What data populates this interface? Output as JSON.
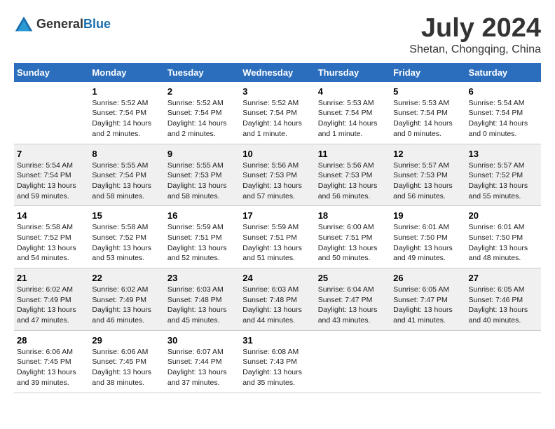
{
  "header": {
    "logo_general": "General",
    "logo_blue": "Blue",
    "title": "July 2024",
    "location": "Shetan, Chongqing, China"
  },
  "columns": [
    "Sunday",
    "Monday",
    "Tuesday",
    "Wednesday",
    "Thursday",
    "Friday",
    "Saturday"
  ],
  "weeks": [
    [
      {
        "day": "",
        "info": ""
      },
      {
        "day": "1",
        "info": "Sunrise: 5:52 AM\nSunset: 7:54 PM\nDaylight: 14 hours\nand 2 minutes."
      },
      {
        "day": "2",
        "info": "Sunrise: 5:52 AM\nSunset: 7:54 PM\nDaylight: 14 hours\nand 2 minutes."
      },
      {
        "day": "3",
        "info": "Sunrise: 5:52 AM\nSunset: 7:54 PM\nDaylight: 14 hours\nand 1 minute."
      },
      {
        "day": "4",
        "info": "Sunrise: 5:53 AM\nSunset: 7:54 PM\nDaylight: 14 hours\nand 1 minute."
      },
      {
        "day": "5",
        "info": "Sunrise: 5:53 AM\nSunset: 7:54 PM\nDaylight: 14 hours\nand 0 minutes."
      },
      {
        "day": "6",
        "info": "Sunrise: 5:54 AM\nSunset: 7:54 PM\nDaylight: 14 hours\nand 0 minutes."
      }
    ],
    [
      {
        "day": "7",
        "info": "Sunrise: 5:54 AM\nSunset: 7:54 PM\nDaylight: 13 hours\nand 59 minutes."
      },
      {
        "day": "8",
        "info": "Sunrise: 5:55 AM\nSunset: 7:54 PM\nDaylight: 13 hours\nand 58 minutes."
      },
      {
        "day": "9",
        "info": "Sunrise: 5:55 AM\nSunset: 7:53 PM\nDaylight: 13 hours\nand 58 minutes."
      },
      {
        "day": "10",
        "info": "Sunrise: 5:56 AM\nSunset: 7:53 PM\nDaylight: 13 hours\nand 57 minutes."
      },
      {
        "day": "11",
        "info": "Sunrise: 5:56 AM\nSunset: 7:53 PM\nDaylight: 13 hours\nand 56 minutes."
      },
      {
        "day": "12",
        "info": "Sunrise: 5:57 AM\nSunset: 7:53 PM\nDaylight: 13 hours\nand 56 minutes."
      },
      {
        "day": "13",
        "info": "Sunrise: 5:57 AM\nSunset: 7:52 PM\nDaylight: 13 hours\nand 55 minutes."
      }
    ],
    [
      {
        "day": "14",
        "info": "Sunrise: 5:58 AM\nSunset: 7:52 PM\nDaylight: 13 hours\nand 54 minutes."
      },
      {
        "day": "15",
        "info": "Sunrise: 5:58 AM\nSunset: 7:52 PM\nDaylight: 13 hours\nand 53 minutes."
      },
      {
        "day": "16",
        "info": "Sunrise: 5:59 AM\nSunset: 7:51 PM\nDaylight: 13 hours\nand 52 minutes."
      },
      {
        "day": "17",
        "info": "Sunrise: 5:59 AM\nSunset: 7:51 PM\nDaylight: 13 hours\nand 51 minutes."
      },
      {
        "day": "18",
        "info": "Sunrise: 6:00 AM\nSunset: 7:51 PM\nDaylight: 13 hours\nand 50 minutes."
      },
      {
        "day": "19",
        "info": "Sunrise: 6:01 AM\nSunset: 7:50 PM\nDaylight: 13 hours\nand 49 minutes."
      },
      {
        "day": "20",
        "info": "Sunrise: 6:01 AM\nSunset: 7:50 PM\nDaylight: 13 hours\nand 48 minutes."
      }
    ],
    [
      {
        "day": "21",
        "info": "Sunrise: 6:02 AM\nSunset: 7:49 PM\nDaylight: 13 hours\nand 47 minutes."
      },
      {
        "day": "22",
        "info": "Sunrise: 6:02 AM\nSunset: 7:49 PM\nDaylight: 13 hours\nand 46 minutes."
      },
      {
        "day": "23",
        "info": "Sunrise: 6:03 AM\nSunset: 7:48 PM\nDaylight: 13 hours\nand 45 minutes."
      },
      {
        "day": "24",
        "info": "Sunrise: 6:03 AM\nSunset: 7:48 PM\nDaylight: 13 hours\nand 44 minutes."
      },
      {
        "day": "25",
        "info": "Sunrise: 6:04 AM\nSunset: 7:47 PM\nDaylight: 13 hours\nand 43 minutes."
      },
      {
        "day": "26",
        "info": "Sunrise: 6:05 AM\nSunset: 7:47 PM\nDaylight: 13 hours\nand 41 minutes."
      },
      {
        "day": "27",
        "info": "Sunrise: 6:05 AM\nSunset: 7:46 PM\nDaylight: 13 hours\nand 40 minutes."
      }
    ],
    [
      {
        "day": "28",
        "info": "Sunrise: 6:06 AM\nSunset: 7:45 PM\nDaylight: 13 hours\nand 39 minutes."
      },
      {
        "day": "29",
        "info": "Sunrise: 6:06 AM\nSunset: 7:45 PM\nDaylight: 13 hours\nand 38 minutes."
      },
      {
        "day": "30",
        "info": "Sunrise: 6:07 AM\nSunset: 7:44 PM\nDaylight: 13 hours\nand 37 minutes."
      },
      {
        "day": "31",
        "info": "Sunrise: 6:08 AM\nSunset: 7:43 PM\nDaylight: 13 hours\nand 35 minutes."
      },
      {
        "day": "",
        "info": ""
      },
      {
        "day": "",
        "info": ""
      },
      {
        "day": "",
        "info": ""
      }
    ]
  ]
}
